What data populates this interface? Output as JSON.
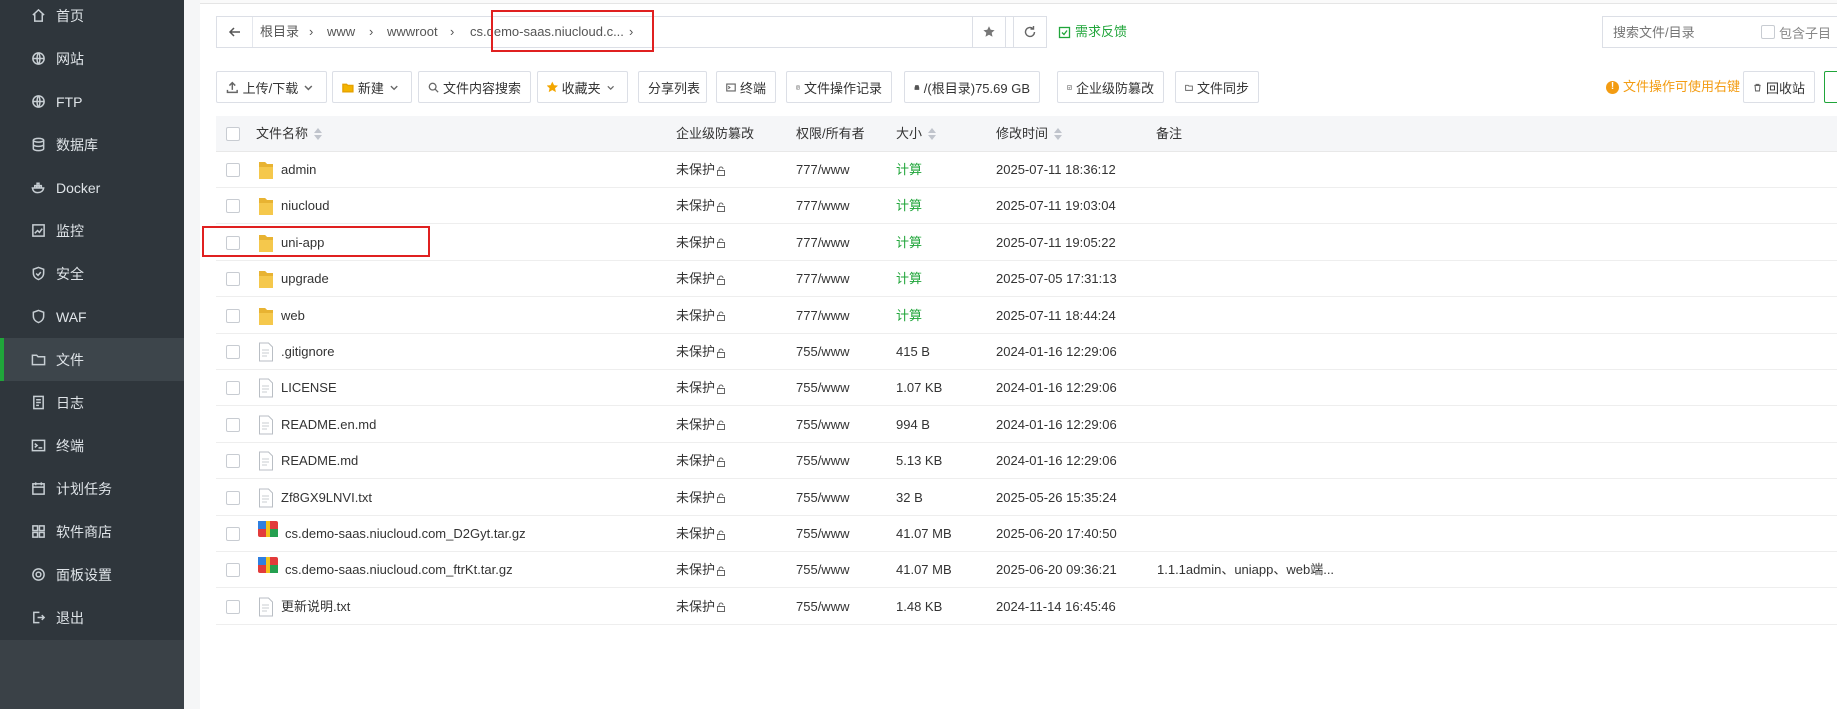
{
  "sidebar": {
    "items": [
      {
        "label": "首页",
        "icon": "home-icon"
      },
      {
        "label": "网站",
        "icon": "globe-icon"
      },
      {
        "label": "FTP",
        "icon": "globe-icon"
      },
      {
        "label": "数据库",
        "icon": "database-icon"
      },
      {
        "label": "Docker",
        "icon": "docker-icon"
      },
      {
        "label": "监控",
        "icon": "monitor-icon"
      },
      {
        "label": "安全",
        "icon": "shield-icon"
      },
      {
        "label": "WAF",
        "icon": "waf-icon"
      },
      {
        "label": "文件",
        "icon": "folder-icon",
        "active": true
      },
      {
        "label": "日志",
        "icon": "log-icon"
      },
      {
        "label": "终端",
        "icon": "terminal-icon"
      },
      {
        "label": "计划任务",
        "icon": "calendar-icon"
      },
      {
        "label": "软件商店",
        "icon": "grid-icon"
      },
      {
        "label": "面板设置",
        "icon": "gear-icon"
      },
      {
        "label": "退出",
        "icon": "logout-icon"
      }
    ]
  },
  "pathbar": {
    "crumbs": [
      "根目录",
      "www",
      "wwwroot",
      "cs.demo-saas.niucloud.c..."
    ],
    "feedback_label": "需求反馈",
    "search_placeholder": "搜索文件/目录",
    "subdir_label": "包含子目"
  },
  "toolbar": {
    "upload": "上传/下载",
    "new": "新建",
    "content_search": "文件内容搜索",
    "favorites": "收藏夹",
    "share_list": "分享列表",
    "terminal": "终端",
    "op_log": "文件操作记录",
    "disk": "/(根目录)75.69 GB",
    "tamper": "企业级防篡改",
    "sync": "文件同步",
    "tip": "文件操作可使用右键",
    "recycle": "回收站"
  },
  "table": {
    "headers": {
      "name": "文件名称",
      "protect": "企业级防篡改",
      "perm": "权限/所有者",
      "size": "大小",
      "mtime": "修改时间",
      "note": "备注"
    },
    "rows": [
      {
        "type": "folder",
        "name": "admin",
        "protect": "未保护",
        "perm": "777/www",
        "size": "计算",
        "mtime": "2025-07-11 18:36:12",
        "note": ""
      },
      {
        "type": "folder",
        "name": "niucloud",
        "protect": "未保护",
        "perm": "777/www",
        "size": "计算",
        "mtime": "2025-07-11 19:03:04",
        "note": ""
      },
      {
        "type": "folder",
        "name": "uni-app",
        "protect": "未保护",
        "perm": "777/www",
        "size": "计算",
        "mtime": "2025-07-11 19:05:22",
        "note": ""
      },
      {
        "type": "folder",
        "name": "upgrade",
        "protect": "未保护",
        "perm": "777/www",
        "size": "计算",
        "mtime": "2025-07-05 17:31:13",
        "note": ""
      },
      {
        "type": "folder",
        "name": "web",
        "protect": "未保护",
        "perm": "777/www",
        "size": "计算",
        "mtime": "2025-07-11 18:44:24",
        "note": ""
      },
      {
        "type": "file",
        "name": ".gitignore",
        "protect": "未保护",
        "perm": "755/www",
        "size": "415 B",
        "mtime": "2024-01-16 12:29:06",
        "note": ""
      },
      {
        "type": "file",
        "name": "LICENSE",
        "protect": "未保护",
        "perm": "755/www",
        "size": "1.07 KB",
        "mtime": "2024-01-16 12:29:06",
        "note": ""
      },
      {
        "type": "file",
        "name": "README.en.md",
        "protect": "未保护",
        "perm": "755/www",
        "size": "994 B",
        "mtime": "2024-01-16 12:29:06",
        "note": ""
      },
      {
        "type": "file",
        "name": "README.md",
        "protect": "未保护",
        "perm": "755/www",
        "size": "5.13 KB",
        "mtime": "2024-01-16 12:29:06",
        "note": ""
      },
      {
        "type": "file",
        "name": "Zf8GX9LNVI.txt",
        "protect": "未保护",
        "perm": "755/www",
        "size": "32 B",
        "mtime": "2025-05-26 15:35:24",
        "note": ""
      },
      {
        "type": "archive",
        "name": "cs.demo-saas.niucloud.com_D2Gyt.tar.gz",
        "protect": "未保护",
        "perm": "755/www",
        "size": "41.07 MB",
        "mtime": "2025-06-20 17:40:50",
        "note": ""
      },
      {
        "type": "archive",
        "name": "cs.demo-saas.niucloud.com_ftrKt.tar.gz",
        "protect": "未保护",
        "perm": "755/www",
        "size": "41.07 MB",
        "mtime": "2025-06-20 09:36:21",
        "note": "1.1.1admin、uniapp、web端..."
      },
      {
        "type": "file",
        "name": "更新说明.txt",
        "protect": "未保护",
        "perm": "755/www",
        "size": "1.48 KB",
        "mtime": "2024-11-14 16:45:46",
        "note": ""
      }
    ]
  },
  "colors": {
    "accent": "#20a53a",
    "sidebar": "#2f363c",
    "highlight": "#e02020",
    "tip": "#f39c12"
  }
}
